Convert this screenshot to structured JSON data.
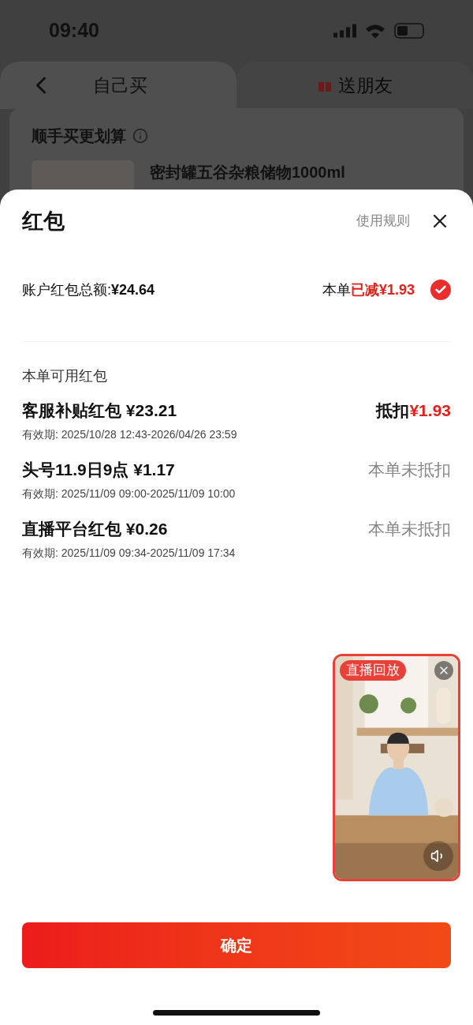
{
  "status_bar": {
    "time": "09:40"
  },
  "tabs": [
    {
      "label": "自己买",
      "selected": true
    },
    {
      "label": "送朋友",
      "selected": false
    }
  ],
  "background_card": {
    "title": "顺手买更划算",
    "product_title": "密封罐五谷杂粮储物1000ml"
  },
  "sheet": {
    "title": "红包",
    "rules_link": "使用规则",
    "total_label": "账户红包总额:",
    "total": "¥24.64",
    "summary_prefix": "本单",
    "summary_highlight": "已减¥1.93",
    "checked": true,
    "list_heading": "本单可用红包",
    "items": [
      {
        "name": "客服补贴红包",
        "amount": "¥23.21",
        "validity_label": "有效期:",
        "validity": "2025/10/28 12:43-2026/04/26 23:59",
        "kind": "applied",
        "status_text": "抵扣",
        "status_amount": "¥1.93"
      },
      {
        "name": "头号11.9日9点",
        "amount": "¥1.17",
        "validity_label": "有效期:",
        "validity": "2025/11/09 09:00-2025/11/09 10:00",
        "kind": "not_applied",
        "status_text": "本单未抵扣"
      },
      {
        "name": "直播平台红包",
        "amount": "¥0.26",
        "validity_label": "有效期:",
        "validity": "2025/11/09 09:34-2025/11/09 17:34",
        "kind": "not_applied",
        "status_text": "本单未抵扣"
      }
    ],
    "video": {
      "kind": "picture",
      "badge": "直播回放"
    },
    "confirm_button": "确定"
  }
}
